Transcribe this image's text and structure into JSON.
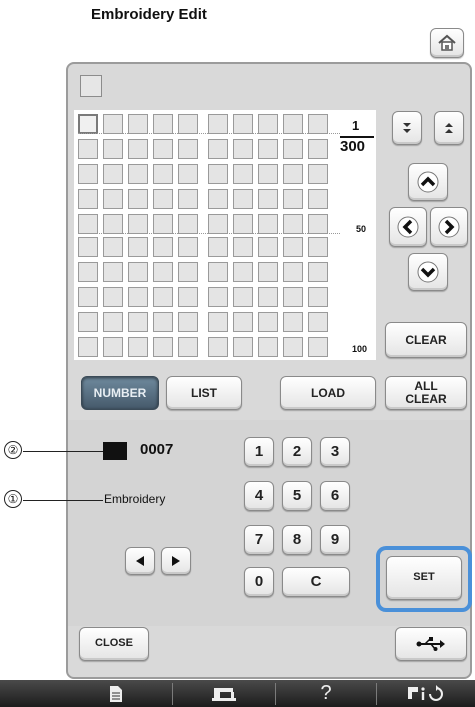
{
  "header": {
    "title": "Embroidery Edit",
    "home_icon": "home-icon"
  },
  "grid": {
    "rows": 10,
    "cols": 10,
    "page_fraction": "1",
    "page_total": "300",
    "mark_50": "50",
    "mark_100": "100"
  },
  "nav": {
    "page_down_icon": "double-chevron-down-icon",
    "page_up_icon": "double-chevron-up-icon",
    "up_icon": "chevron-up-icon",
    "left_icon": "chevron-left-icon",
    "right_icon": "chevron-right-icon",
    "down_icon": "chevron-down-icon"
  },
  "buttons": {
    "clear": "CLEAR",
    "number": "NUMBER",
    "list": "LIST",
    "load": "LOAD",
    "all_clear_line1": "ALL",
    "all_clear_line2": "CLEAR",
    "set": "SET",
    "close": "CLOSE"
  },
  "entry": {
    "swatch_color": "#111111",
    "number": "0007",
    "name": "Embroidery"
  },
  "keypad": [
    "1",
    "2",
    "3",
    "4",
    "5",
    "6",
    "7",
    "8",
    "9",
    "0",
    "C"
  ],
  "callouts": {
    "one": "①",
    "two": "②"
  },
  "tabbar": {
    "tab1_icon": "document-icon",
    "tab2_icon": "sewing-machine-icon",
    "tab3_label": "?",
    "tab4_icon": "info-settings-icon"
  },
  "colors": {
    "accent": "#4a90d9",
    "panel": "#d9d9d9"
  }
}
